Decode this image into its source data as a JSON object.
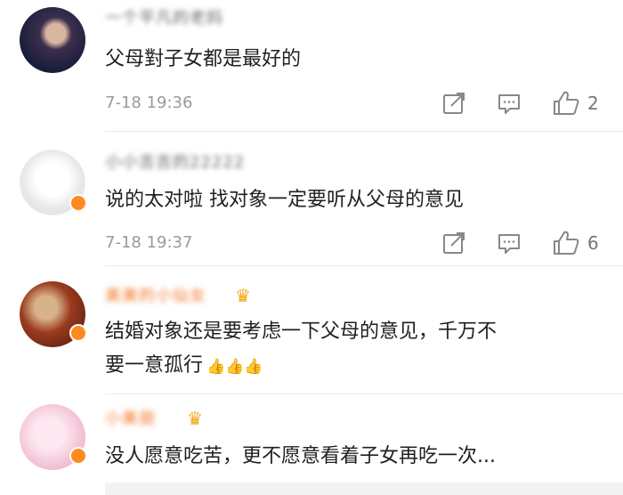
{
  "comments": [
    {
      "username": "一个平凡的老妈",
      "text": "父母對子女都是最好的",
      "time": "7-18 19:36",
      "likes": "2"
    },
    {
      "username": "小小吉吉的22222",
      "text": "说的太对啦 找对象一定要听从父母的意见",
      "time": "7-18 19:37",
      "likes": "6"
    },
    {
      "username": "美美的小仙女",
      "text_line1": "结婚对象还是要考虑一下父母的意见，千万不",
      "text_line2": "要一意孤行",
      "thumbs": "👍👍👍"
    },
    {
      "username": "小美丽",
      "text": "没人愿意吃苦，更不愿意看着子女再吃一次..."
    }
  ],
  "icons": {
    "share": "share-icon",
    "reply": "comment-icon",
    "like": "thumbs-up-icon",
    "vip": "crown-icon"
  },
  "colors": {
    "meta_gray": "#9a9a9a",
    "vip_orange": "#f0782a",
    "verified_badge": "#ff8a1f"
  }
}
